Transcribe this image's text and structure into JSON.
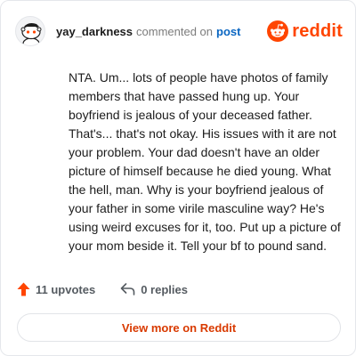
{
  "header": {
    "author": "yay_darkness",
    "action": "commented on",
    "post_link": "post",
    "brand": "reddit",
    "avatar_icon": "snoo-avatar-icon",
    "brand_icon": "reddit-logo-icon",
    "brand_color": "#ff4500"
  },
  "comment": {
    "body": "NTA. Um... lots of people have photos of family members that have passed hung up. Your boyfriend is jealous of your deceased father. That's... that's not okay. His issues with it are not your problem. Your dad doesn't have an older picture of himself because he died young. What the hell, man. Why is your boyfriend jealous of your father in some virile masculine way? He's using weird excuses for it, too. Put up a picture of your mom beside it. Tell your bf to pound sand."
  },
  "stats": {
    "upvotes_label": "11 upvotes",
    "upvote_icon": "upvote-arrow-icon",
    "upvote_color": "#ff4500",
    "replies_label": "0 replies",
    "reply_icon": "reply-arrow-icon"
  },
  "cta": {
    "label": "View more on Reddit",
    "color": "#d93a00"
  }
}
